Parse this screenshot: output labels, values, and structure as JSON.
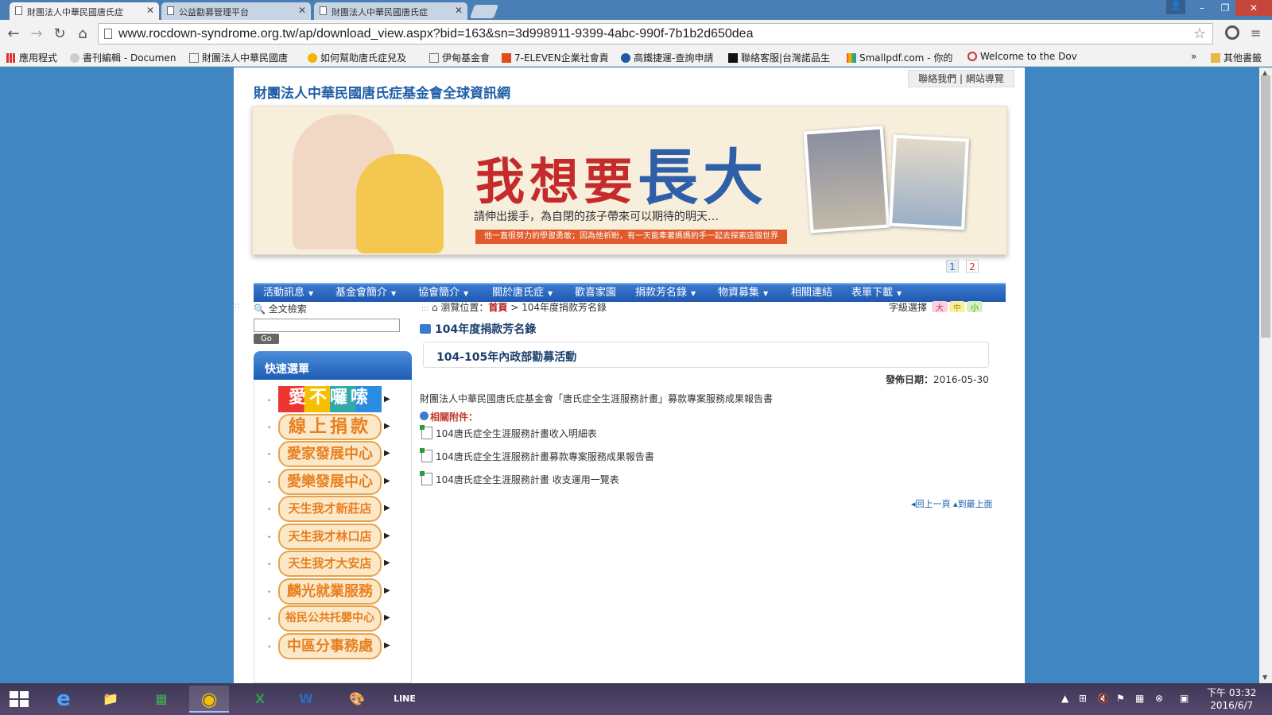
{
  "browser": {
    "tabs": [
      {
        "title": "財團法人中華民國唐氏症",
        "active": true
      },
      {
        "title": "公益勸募管理平台",
        "active": false
      },
      {
        "title": "財團法人中華民國唐氏症",
        "active": false
      }
    ],
    "close_glyph": "✕",
    "url": "www.rocdown-syndrome.org.tw/ap/download_view.aspx?bid=163&sn=3d998911-9399-4abc-990f-7b1b2d650dea",
    "bookmarks": [
      "應用程式",
      "書刊編輯 - Documen",
      "財團法人中華民國唐",
      "如何幫助唐氏症兒及",
      "伊甸基金會",
      "7-ELEVEN企業社會責",
      "高鐵捷運-查詢申請",
      "聯絡客服|台灣諾品生",
      "Smallpdf.com - 你的",
      "Welcome to the Dov"
    ],
    "bookmarks_more": "»",
    "other_bookmarks": "其他書籤"
  },
  "site": {
    "title": "財團法人中華民國唐氏症基金會全球資訊網",
    "top_links": [
      "聯絡我們",
      "網站導覽"
    ],
    "banner": {
      "title_red": "我想要",
      "title_blue": "長大",
      "subtitle": "請伸出援手，為自閉的孩子帶來可以期待的明天…",
      "strip": "他一直很努力的學習勇敢；因為他祈盼，有一天能牽著媽媽的手一起去探索這個世界"
    },
    "pager": [
      "1",
      "2"
    ],
    "nav": [
      {
        "label": "活動訊息",
        "dropdown": true
      },
      {
        "label": "基金會簡介",
        "dropdown": true
      },
      {
        "label": "協會簡介",
        "dropdown": true
      },
      {
        "label": "關於唐氏症",
        "dropdown": true
      },
      {
        "label": "歡喜家園",
        "dropdown": false
      },
      {
        "label": "捐款芳名錄",
        "dropdown": true
      },
      {
        "label": "物資募集",
        "dropdown": true
      },
      {
        "label": "相關連結",
        "dropdown": false
      },
      {
        "label": "表單下載",
        "dropdown": true
      }
    ],
    "search": {
      "label": "全文檢索",
      "button": "Go",
      "value": ""
    },
    "quick_menu": {
      "title": "快速選單",
      "items": [
        "愛不囉嗦",
        "線上捐款",
        "愛家發展中心",
        "愛樂發展中心",
        "天生我才新莊店",
        "天生我才林口店",
        "天生我才大安店",
        "麟光就業服務",
        "裕民公共托嬰中心",
        "中區分事務處"
      ]
    },
    "breadcrumb": {
      "label": "瀏覽位置：",
      "home": "首頁",
      "sep": ">",
      "current": "104年度捐款芳名錄"
    },
    "font_select": {
      "label": "字級選擇",
      "sizes": [
        "大",
        "中",
        "小"
      ]
    },
    "section_title": "104年度捐款芳名錄",
    "article_title": "104-105年內政部勸募活動",
    "publish_date_label": "發佈日期：",
    "publish_date": "2016-05-30",
    "description": "財團法人中華民國唐氏症基金會「唐氏症全生涯服務計畫」募款專案服務成果報告書",
    "attachments_label": "相關附件：",
    "attachments": [
      "104唐氏症全生涯服務計畫收入明細表",
      "104唐氏症全生涯服務計畫募款專案服務成果報告書",
      "104唐氏症全生涯服務計畫 收支運用一覽表"
    ],
    "back_link": "回上一頁",
    "top_link": "到最上面"
  },
  "taskbar": {
    "apps": [
      "e",
      "📁",
      "▦",
      "◉",
      "X",
      "W",
      "🎨",
      "LINE"
    ],
    "time": "下午 03:32",
    "date": "2016/6/7"
  },
  "colors": {
    "nav_blue": "#2a67c2",
    "title_blue": "#1f5ea8",
    "home_red": "#b31d1d"
  }
}
